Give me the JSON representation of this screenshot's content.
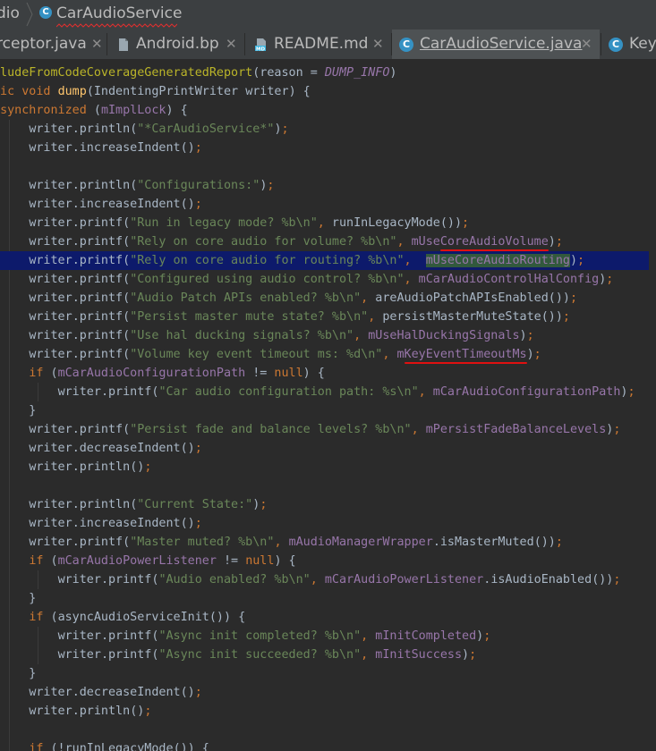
{
  "breadcrumb": {
    "previous": "dio",
    "current": "CarAudioService"
  },
  "tabs": [
    {
      "label": "rceptor.java",
      "icon": "java-class-icon",
      "active": false
    },
    {
      "label": "Android.bp",
      "icon": "file-icon",
      "active": false
    },
    {
      "label": "README.md",
      "icon": "markdown-icon",
      "active": false
    },
    {
      "label": "CarAudioService.java",
      "icon": "java-class-icon",
      "active": true
    },
    {
      "label": "Key",
      "icon": "java-class-icon",
      "active": false
    }
  ],
  "code": {
    "lines": [
      "cludeFromCodeCoverageGeneratedReport(reason = DUMP_INFO)",
      "lic void dump(IndentingPrintWriter writer) {",
      " synchronized (mImplLock) {",
      "     writer.println(\"*CarAudioService*\");",
      "     writer.increaseIndent();",
      "",
      "     writer.println(\"Configurations:\");",
      "     writer.increaseIndent();",
      "     writer.printf(\"Run in legacy mode? %b\\n\", runInLegacyMode());",
      "     writer.printf(\"Rely on core audio for volume? %b\\n\", mUseCoreAudioVolume);",
      "     writer.printf(\"Rely on core audio for routing? %b\\n\",  mUseCoreAudioRouting);",
      "     writer.printf(\"Configured using audio control? %b\\n\", mCarAudioControlHalConfig);",
      "     writer.printf(\"Audio Patch APIs enabled? %b\\n\", areAudioPatchAPIsEnabled());",
      "     writer.printf(\"Persist master mute state? %b\\n\", persistMasterMuteState());",
      "     writer.printf(\"Use hal ducking signals? %b\\n\", mUseHalDuckingSignals);",
      "     writer.printf(\"Volume key event timeout ms: %d\\n\", mKeyEventTimeoutMs);",
      "     if (mCarAudioConfigurationPath != null) {",
      "         writer.printf(\"Car audio configuration path: %s\\n\", mCarAudioConfigurationPath);",
      "     }",
      "     writer.printf(\"Persist fade and balance levels? %b\\n\", mPersistFadeBalanceLevels);",
      "     writer.decreaseIndent();",
      "     writer.println();",
      "",
      "     writer.println(\"Current State:\");",
      "     writer.increaseIndent();",
      "     writer.printf(\"Master muted? %b\\n\", mAudioManagerWrapper.isMasterMuted());",
      "     if (mCarAudioPowerListener != null) {",
      "         writer.printf(\"Audio enabled? %b\\n\", mCarAudioPowerListener.isAudioEnabled());",
      "     }",
      "     if (asyncAudioServiceInit()) {",
      "         writer.printf(\"Async init completed? %b\\n\", mInitCompleted);",
      "         writer.printf(\"Async init succeeded? %b\\n\", mInitSuccess);",
      "     }",
      "     writer.decreaseIndent();",
      "     writer.println();",
      "",
      "     if (!runInLegacyMode()) {"
    ],
    "highlighted_line": 10,
    "colors": {
      "background": "#2b2b2b",
      "keyword": "#cc7832",
      "string": "#6a8759",
      "field": "#9876aa",
      "method": "#ffc66d",
      "text": "#a9b7c6",
      "line_highlight": "#0d1a6b",
      "match_highlight": "#32593d",
      "annotation_underline": "#e01010"
    }
  }
}
